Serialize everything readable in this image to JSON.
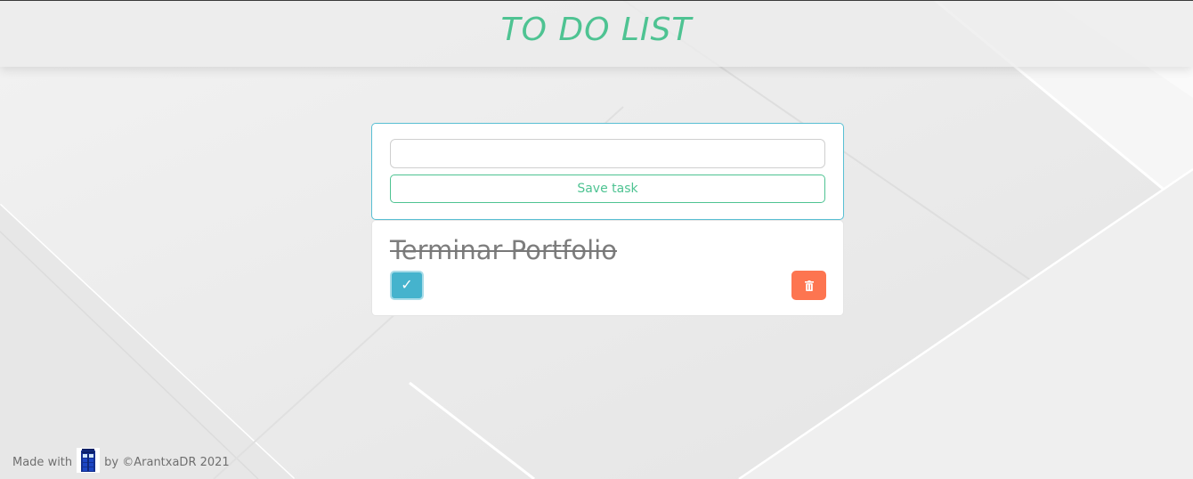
{
  "header": {
    "title": "TO DO LIST"
  },
  "form": {
    "input_value": "",
    "input_placeholder": "",
    "save_label": "Save task"
  },
  "tasks": [
    {
      "text": "Terminar Portfolio",
      "done": true,
      "check_icon": "✓",
      "delete_icon": "trash-icon"
    }
  ],
  "footer": {
    "prefix": "Made with",
    "icon": "tardis-icon",
    "suffix": "by ©ArantxaDR 2021"
  },
  "colors": {
    "accent": "#4ec392",
    "border": "#58bfd3",
    "check": "#45b3cd",
    "delete": "#fd7550",
    "background": "#ececec"
  }
}
